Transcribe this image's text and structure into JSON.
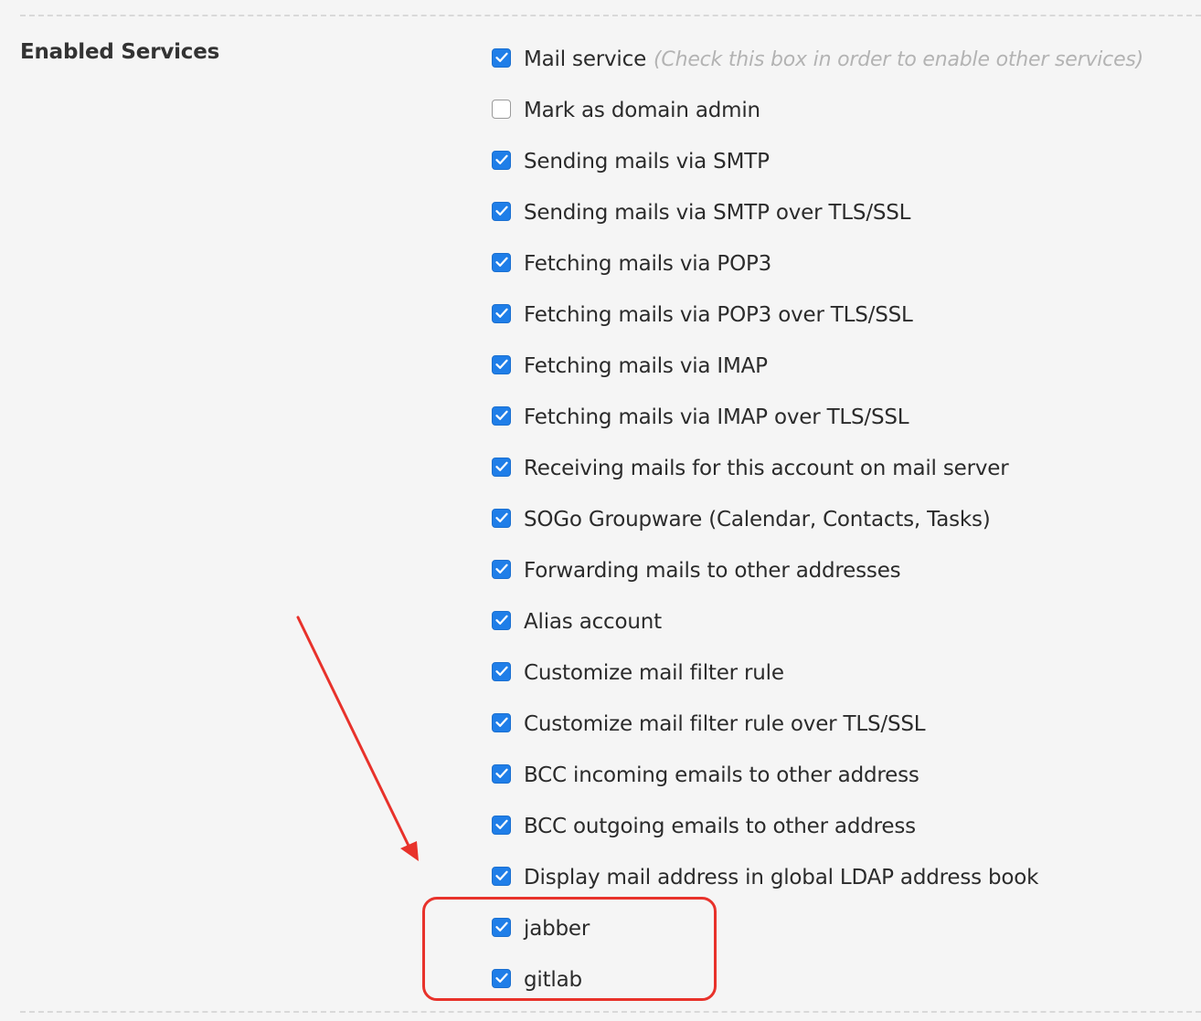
{
  "section": {
    "label": "Enabled Services"
  },
  "services": [
    {
      "label": "Mail service",
      "hint": "(Check this box in order to enable other services)",
      "checked": true
    },
    {
      "label": "Mark as domain admin",
      "hint": "",
      "checked": false
    },
    {
      "label": "Sending mails via SMTP",
      "hint": "",
      "checked": true
    },
    {
      "label": "Sending mails via SMTP over TLS/SSL",
      "hint": "",
      "checked": true
    },
    {
      "label": "Fetching mails via POP3",
      "hint": "",
      "checked": true
    },
    {
      "label": "Fetching mails via POP3 over TLS/SSL",
      "hint": "",
      "checked": true
    },
    {
      "label": "Fetching mails via IMAP",
      "hint": "",
      "checked": true
    },
    {
      "label": "Fetching mails via IMAP over TLS/SSL",
      "hint": "",
      "checked": true
    },
    {
      "label": "Receiving mails for this account on mail server",
      "hint": "",
      "checked": true
    },
    {
      "label": "SOGo Groupware (Calendar, Contacts, Tasks)",
      "hint": "",
      "checked": true
    },
    {
      "label": "Forwarding mails to other addresses",
      "hint": "",
      "checked": true
    },
    {
      "label": "Alias account",
      "hint": "",
      "checked": true
    },
    {
      "label": "Customize mail filter rule",
      "hint": "",
      "checked": true
    },
    {
      "label": "Customize mail filter rule over TLS/SSL",
      "hint": "",
      "checked": true
    },
    {
      "label": "BCC incoming emails to other address",
      "hint": "",
      "checked": true
    },
    {
      "label": "BCC outgoing emails to other address",
      "hint": "",
      "checked": true
    },
    {
      "label": "Display mail address in global LDAP address book",
      "hint": "",
      "checked": true
    },
    {
      "label": "jabber",
      "hint": "",
      "checked": true
    },
    {
      "label": "gitlab",
      "hint": "",
      "checked": true
    }
  ],
  "colors": {
    "checkbox_checked": "#1f7ee8",
    "annotation": "#e8322b",
    "hint_text": "#b3b3b3"
  }
}
